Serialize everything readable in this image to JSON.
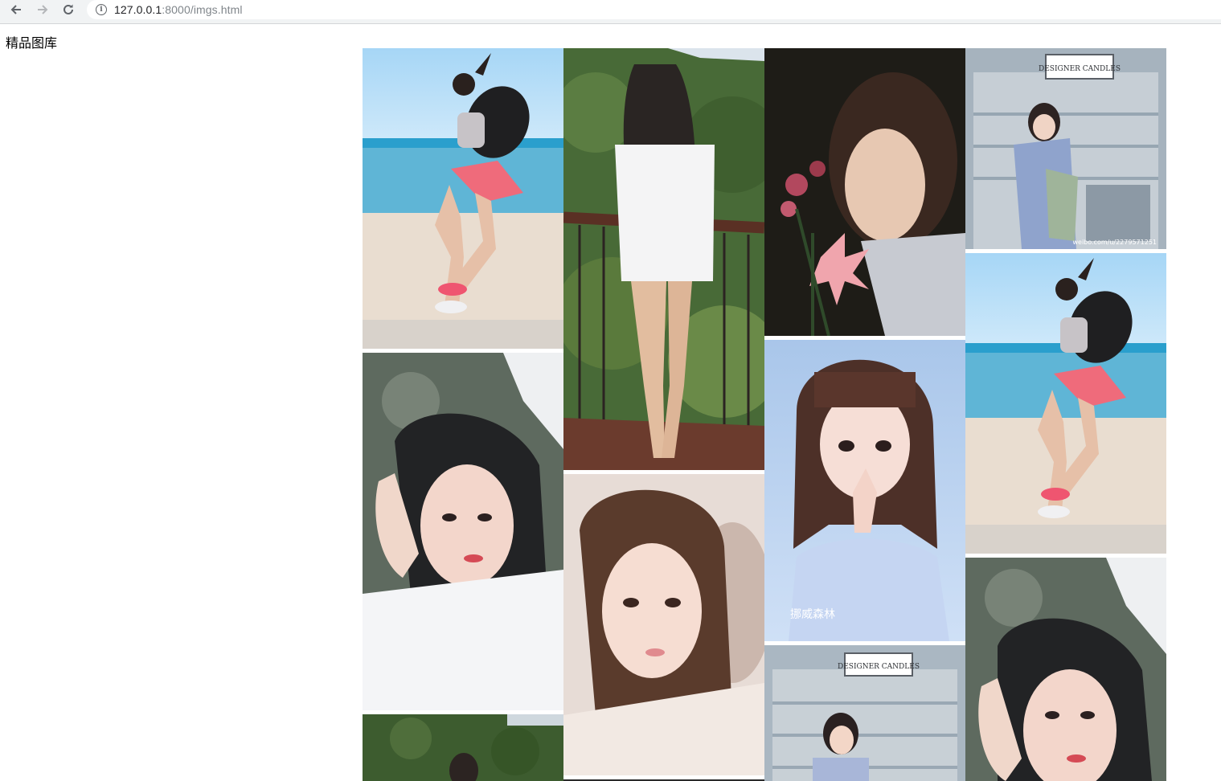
{
  "browser": {
    "url_host": "127.0.0.1",
    "url_path": ":8000/imgs.html",
    "back_icon": "arrow-left",
    "forward_icon": "arrow-right",
    "reload_icon": "reload",
    "info_icon": "info-circle"
  },
  "page": {
    "title": "精品图库"
  },
  "gallery": {
    "watermarks": {
      "candles_sign": "DESIGNER CANDLES",
      "weibo_credit": "weibo.com/u/2279571251",
      "forest_caption": "挪威森林"
    }
  }
}
